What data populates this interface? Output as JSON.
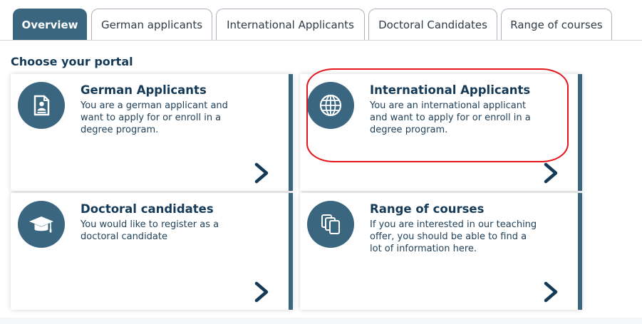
{
  "tabs": [
    {
      "label": "Overview",
      "active": true
    },
    {
      "label": "German applicants"
    },
    {
      "label": "International Applicants"
    },
    {
      "label": "Doctoral Candidates"
    },
    {
      "label": "Range of courses"
    }
  ],
  "heading": "Choose your portal",
  "cards": [
    {
      "title": "German Applicants",
      "description": "You are a german applicant and want to apply for or enroll in a degree program.",
      "icon": "document-icon"
    },
    {
      "title": "International Applicants",
      "description": "You are an international applicant and want to apply for or enroll in a degree program.",
      "icon": "globe-icon"
    },
    {
      "title": "Doctoral candidates",
      "description": "You would like to register as a doctoral candidate",
      "icon": "graduation-cap-icon"
    },
    {
      "title": "Range of courses",
      "description": "If you are interested in our teaching offer, you should be able to find a lot of information here.",
      "icon": "books-icon"
    }
  ],
  "colors": {
    "accent": "#3a6680",
    "title": "#153a57",
    "highlight": "#e3161b"
  }
}
